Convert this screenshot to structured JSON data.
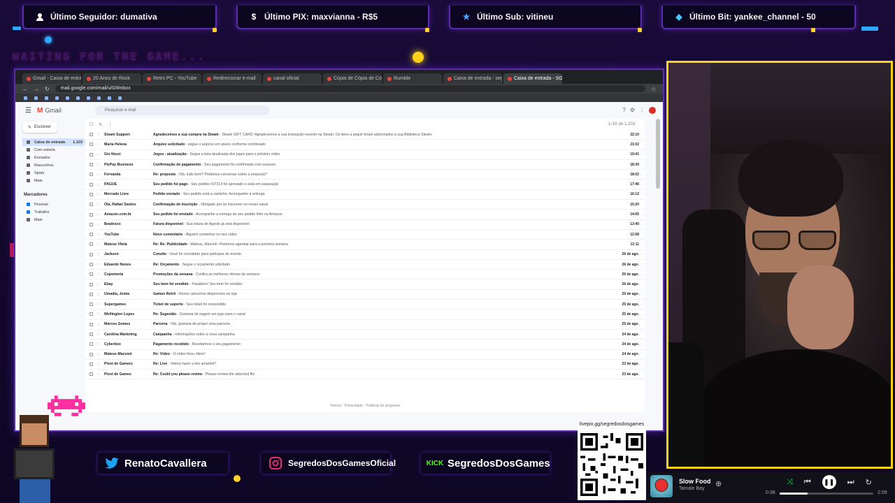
{
  "alerts": [
    {
      "icon": "user-icon",
      "text": "Último Seguidor: dumativa"
    },
    {
      "icon": "dollar-icon",
      "text": "Último PIX: maxvianna - R$5"
    },
    {
      "icon": "star-icon",
      "text": "Último Sub: vitineu"
    },
    {
      "icon": "diamond-icon",
      "text": "Último Bit: yankee_channel - 50"
    }
  ],
  "overlay_text": "WAITING FOR THE GAME...",
  "browser": {
    "url": "mail.google.com/mail/u/0/#inbox",
    "tabs": [
      "Gmail - Caixa de entrada",
      "20 Anos de Rock",
      "Retro PC - YouTube",
      "Redirecionar e-mail",
      "canal oficial",
      "Cópia de Cópia de Cópia",
      "Rumble",
      "Caixa de entrada - sego",
      "Caixa de entrada - SGDG"
    ]
  },
  "gmail": {
    "app_name": "Gmail",
    "search_placeholder": "Pesquisar e-mail",
    "compose_label": "Escrever",
    "sidebar": [
      {
        "label": "Caixa de entrada",
        "count": "1.103",
        "selected": true
      },
      {
        "label": "Com estrela",
        "count": ""
      },
      {
        "label": "Enviados",
        "count": ""
      },
      {
        "label": "Rascunhos",
        "count": ""
      },
      {
        "label": "Spam",
        "count": ""
      },
      {
        "label": "Mais",
        "count": ""
      }
    ],
    "labels_header": "Marcadores",
    "labels": [
      "Pessoal",
      "Trabalho",
      "Mais"
    ],
    "pagination": "1–50 de 1.203",
    "emails": [
      {
        "sender": "Steam Support",
        "subject": "Agradecemos a sua compra na Steam",
        "snippet": "Steam GIFT CARD: Agradecemos a sua transação recente na Steam. Os itens a seguir foram adicionados à sua Biblioteca Steam.",
        "date": "22:10"
      },
      {
        "sender": "Maria Helena",
        "subject": "Arquivo solicitado",
        "snippet": "segue o arquivo em anexo conforme combinado",
        "date": "21:02"
      },
      {
        "sender": "Gio Nozzi",
        "subject": "Jogos - atualização",
        "snippet": "Segue a lista atualizada dos jogos para o próximo vídeo",
        "date": "19:41"
      },
      {
        "sender": "PicPay Business",
        "subject": "Confirmação de pagamento",
        "snippet": "Seu pagamento foi confirmado com sucesso",
        "date": "18:30"
      },
      {
        "sender": "Fernanda",
        "subject": "Re: proposta",
        "snippet": "Olá, tudo bem? Podemos conversar sobre a proposta?",
        "date": "18:02"
      },
      {
        "sender": "PAGUE",
        "subject": "Seu pedido foi pago",
        "snippet": "Seu pedido #37214 foi aprovado e está em separação",
        "date": "17:46"
      },
      {
        "sender": "Mercado Livre",
        "subject": "Pedido enviado",
        "snippet": "Seu pedido está a caminho. Acompanhe a entrega",
        "date": "16:12"
      },
      {
        "sender": "Ola, Rafael Santos",
        "subject": "Confirmação de inscrição",
        "snippet": "Obrigado por se inscrever no nosso canal",
        "date": "15:20"
      },
      {
        "sender": "Amazon.com.br",
        "subject": "Seu pedido foi enviado",
        "snippet": "Acompanhe a entrega do seu pedido feito na Amazon",
        "date": "14:05"
      },
      {
        "sender": "Bradesco",
        "subject": "Fatura disponível",
        "snippet": "Sua fatura de Agosto já está disponível",
        "date": "13:40"
      },
      {
        "sender": "YouTube",
        "subject": "Novo comentário",
        "snippet": "Alguém comentou no seu vídeo",
        "date": "12:58"
      },
      {
        "sender": "Mateus Vilela",
        "subject": "Re: Re: Publicidade",
        "snippet": "Mateus, Marcelo: Podemos agendar para a próxima semana",
        "date": "12:11"
      },
      {
        "sender": "Jackson",
        "subject": "Convite",
        "snippet": "Você foi convidado para participar do evento",
        "date": "26 de ago."
      },
      {
        "sender": "Eduardo Nunes",
        "subject": "Re: Orçamento",
        "snippet": "Segue o orçamento solicitado",
        "date": "26 de ago."
      },
      {
        "sender": "Cupomeria",
        "subject": "Promoções da semana",
        "snippet": "Confira as melhores ofertas da semana",
        "date": "26 de ago."
      },
      {
        "sender": "Ebay",
        "subject": "Seu item foi vendido",
        "snippet": "Parabéns! Seu item foi vendido",
        "date": "26 de ago."
      },
      {
        "sender": "Umadia, Jeska",
        "subject": "Games Retrô",
        "snippet": "Novos cartuchos disponíveis na loja",
        "date": "25 de ago."
      },
      {
        "sender": "Supergames",
        "subject": "Ticket de suporte",
        "snippet": "Seu ticket foi respondido",
        "date": "25 de ago."
      },
      {
        "sender": "Wellington Lopes",
        "subject": "Re: Sugestão",
        "snippet": "Gostaria de sugerir um jogo para o canal",
        "date": "25 de ago."
      },
      {
        "sender": "Marcos Gomes",
        "subject": "Parceria",
        "snippet": "Olá, gostaria de propor uma parceria",
        "date": "25 de ago."
      },
      {
        "sender": "Carolina Marketing",
        "subject": "Campanha",
        "snippet": "Informações sobre a nova campanha",
        "date": "24 de ago."
      },
      {
        "sender": "Cyberbox",
        "subject": "Pagamento recebido",
        "snippet": "Recebemos o seu pagamento",
        "date": "24 de ago."
      },
      {
        "sender": "Mateus Mazzoni",
        "subject": "Re: Vídeo",
        "snippet": "O vídeo ficou ótimo!",
        "date": "24 de ago."
      },
      {
        "sender": "Pivot de Gamers",
        "subject": "Re: Live",
        "snippet": "Vamos fazer a live amanhã?",
        "date": "23 de ago."
      },
      {
        "sender": "Pivot de Games",
        "subject": "Re: Could you please review",
        "snippet": "Please review the attached file",
        "date": "23 de ago."
      }
    ],
    "footer": "Termos · Privacidade · Políticas do programa"
  },
  "socials": [
    {
      "icon": "twitter-icon",
      "badge": "",
      "text": "RenatoCavallera",
      "color": "#1da1f2"
    },
    {
      "icon": "instagram-icon",
      "badge": "",
      "text": "SegredosDosGamesOficial",
      "color": "#e1306c"
    },
    {
      "icon": "kick-icon",
      "badge": "KICK",
      "text": "SegredosDosGames",
      "color": "#53fc18"
    }
  ],
  "qr_label": "livepix.gg/segredosdosgames",
  "player": {
    "song": "Slow Food",
    "artist": "Tamale Bay",
    "elapsed": "0:38",
    "duration": "2:09",
    "progress": 0.3
  },
  "colors": {
    "frame": "#5b2bb0",
    "cam_border": "#ffd21a",
    "accent": "#ffd21a"
  }
}
